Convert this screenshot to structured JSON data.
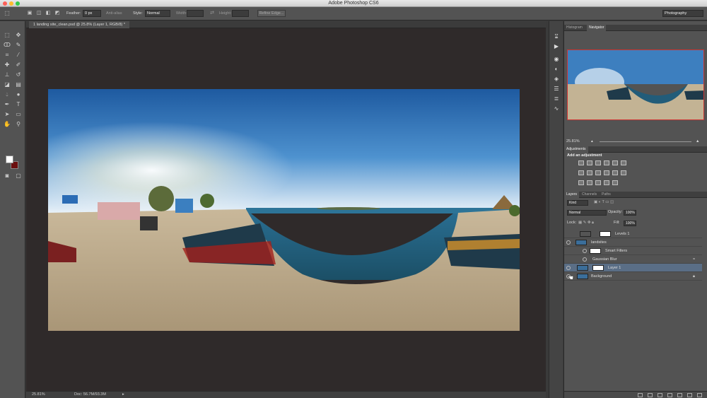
{
  "window": {
    "title": "Adobe Photoshop CS6"
  },
  "options": {
    "feather_label": "Feather:",
    "feather_value": "0 px",
    "antialias_label": "Anti-alias",
    "style_label": "Style:",
    "style_value": "Normal",
    "width_label": "Width:",
    "height_label": "Height:",
    "refine_edge": "Refine Edge...",
    "workspace": "Photography"
  },
  "document": {
    "tab_label": "1 landing site_clean.psd @ 25.8% (Layer 1, RGB/8) *",
    "zoom": "25.81%",
    "doc_size": "Doc: 56.7M/93.3M"
  },
  "navigator": {
    "tabs": [
      "Histogram",
      "Navigator"
    ],
    "active_tab": "Navigator",
    "zoom": "25.81%"
  },
  "adjustments": {
    "tab": "Adjustments",
    "title": "Add an adjustment"
  },
  "layers_panel": {
    "tabs": [
      "Layers",
      "Channels",
      "Paths"
    ],
    "active_tab": "Layers",
    "kind": "Kind",
    "blend_mode": "Normal",
    "opacity_label": "Opacity:",
    "opacity_value": "100%",
    "lock_label": "Lock:",
    "fill_label": "Fill:",
    "fill_value": "100%",
    "layers": [
      {
        "name": "Levels 1",
        "visible": false,
        "selected": false
      },
      {
        "name": "landsites",
        "visible": true,
        "selected": false
      },
      {
        "name": "Smart Filters",
        "visible": true,
        "selected": false
      },
      {
        "name": "Gaussian Blur",
        "visible": true,
        "selected": false
      },
      {
        "name": "Layer 1",
        "visible": true,
        "selected": true
      },
      {
        "name": "Background",
        "visible": true,
        "selected": false
      }
    ]
  },
  "colors": {
    "foreground": "#ffffff",
    "background": "#6b0f0f",
    "selection": "#5a6e86",
    "navigator_frame": "#cc3333"
  },
  "icons": {
    "tools": [
      "marquee-icon",
      "lasso-icon",
      "crop-icon",
      "eyedropper-icon",
      "healing-icon",
      "brush-icon",
      "stamp-icon",
      "history-brush-icon",
      "eraser-icon",
      "gradient-icon",
      "blur-icon",
      "dodge-icon",
      "pen-icon",
      "type-icon",
      "path-select-icon",
      "shape-icon",
      "hand-icon",
      "zoom-icon"
    ],
    "strip": [
      "history-icon",
      "play-icon",
      "navigator-icon",
      "adjustments-icon",
      "styles-icon",
      "layers-icon",
      "channels-icon",
      "paths-icon"
    ]
  }
}
